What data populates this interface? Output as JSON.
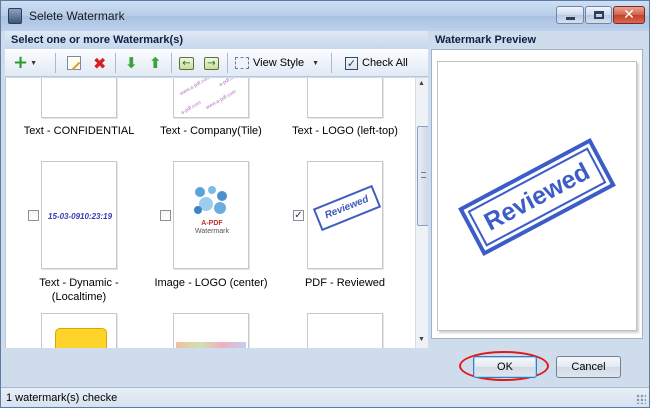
{
  "window": {
    "title": "Selete Watermark"
  },
  "sections": {
    "left_header": "Select one or more Watermark(s)",
    "right_header": "Watermark Preview"
  },
  "toolbar": {
    "view_style_label": "View Style",
    "check_all_label": "Check All",
    "check_all_checked": true
  },
  "gallery": {
    "row1": [
      {
        "label": "Text - CONFIDENTIAL"
      },
      {
        "label": "Text - Company(Tile)"
      },
      {
        "label": "Text - LOGO (left-top)"
      }
    ],
    "row2": [
      {
        "label": "Text - Dynamic - (Localtime)",
        "label_line1": "Text - Dynamic -",
        "label_line2": "(Localtime)",
        "checked": false,
        "thumb_text": "15-03-0910:23:19"
      },
      {
        "label": "Image - LOGO (center)",
        "checked": false,
        "thumb_text1": "A-PDF",
        "thumb_text2": "Watermark"
      },
      {
        "label": "PDF - Reviewed",
        "checked": true,
        "thumb_text": "Reviewed"
      }
    ]
  },
  "preview": {
    "stamp_text": "Reviewed",
    "stamp_color": "#3c5cc8"
  },
  "buttons": {
    "ok": "OK",
    "cancel": "Cancel"
  },
  "status": {
    "text": "1 watermark(s) checke"
  },
  "icons": [
    "app-icon",
    "add-icon",
    "edit-icon",
    "delete-icon",
    "move-down-icon",
    "move-up-icon",
    "import-icon",
    "export-icon",
    "view-style-icon"
  ]
}
